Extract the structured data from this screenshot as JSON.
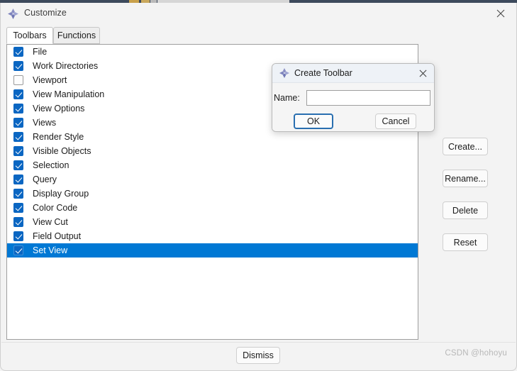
{
  "window": {
    "title": "Customize",
    "icon": "abaqus-diamond-icon",
    "close_label": "✕"
  },
  "tabs": [
    {
      "label": "Toolbars",
      "active": true
    },
    {
      "label": "Functions",
      "active": false
    }
  ],
  "list": {
    "items": [
      {
        "label": "File",
        "checked": true,
        "selected": false
      },
      {
        "label": "Work Directories",
        "checked": true,
        "selected": false
      },
      {
        "label": "Viewport",
        "checked": false,
        "selected": false
      },
      {
        "label": "View Manipulation",
        "checked": true,
        "selected": false
      },
      {
        "label": "View Options",
        "checked": true,
        "selected": false
      },
      {
        "label": "Views",
        "checked": true,
        "selected": false
      },
      {
        "label": "Render Style",
        "checked": true,
        "selected": false
      },
      {
        "label": "Visible Objects",
        "checked": true,
        "selected": false
      },
      {
        "label": "Selection",
        "checked": true,
        "selected": false
      },
      {
        "label": "Query",
        "checked": true,
        "selected": false
      },
      {
        "label": "Display Group",
        "checked": true,
        "selected": false
      },
      {
        "label": "Color Code",
        "checked": true,
        "selected": false
      },
      {
        "label": "View Cut",
        "checked": true,
        "selected": false
      },
      {
        "label": "Field Output",
        "checked": true,
        "selected": false
      },
      {
        "label": "Set View",
        "checked": true,
        "selected": true
      }
    ]
  },
  "side_buttons": [
    {
      "label": "Create...",
      "name": "create-button"
    },
    {
      "label": "Rename...",
      "name": "rename-button"
    },
    {
      "label": "Delete",
      "name": "delete-button"
    },
    {
      "label": "Reset",
      "name": "reset-button"
    }
  ],
  "footer": {
    "dismiss_label": "Dismiss",
    "watermark": "CSDN @hohoyu"
  },
  "modal": {
    "title": "Create Toolbar",
    "icon": "abaqus-diamond-icon",
    "close_label": "✕",
    "name_label": "Name:",
    "name_value": "",
    "name_placeholder": "",
    "ok_label": "OK",
    "cancel_label": "Cancel"
  },
  "colors": {
    "selection": "#0078d4",
    "checkbox": "#0a66c2",
    "focus_ring": "#2a6fb0",
    "behind_window_bar": "#3d4a5c"
  }
}
